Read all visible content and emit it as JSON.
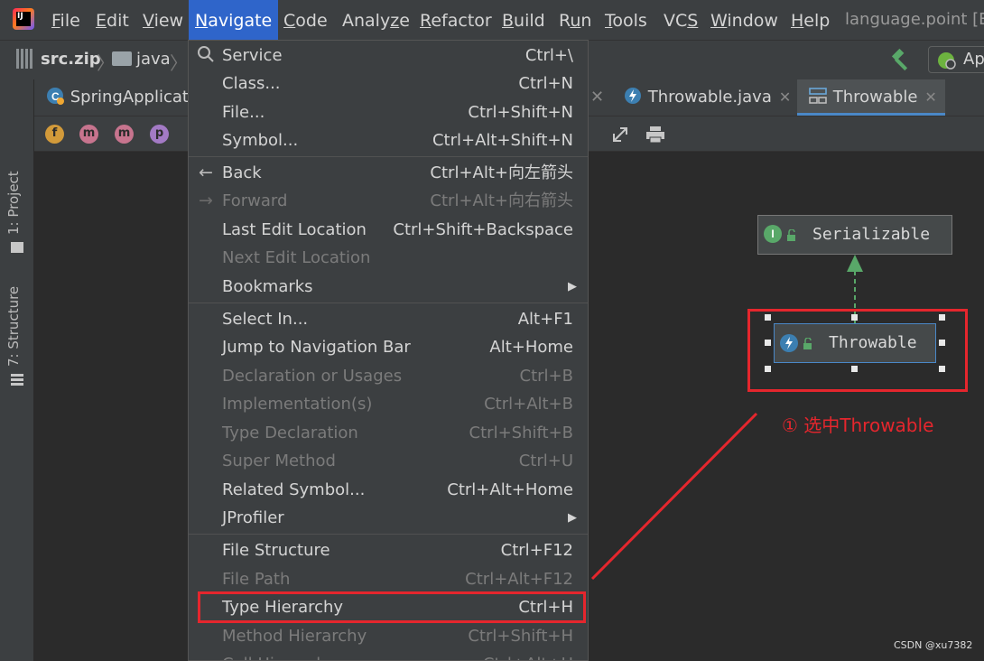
{
  "menubar": {
    "items": [
      {
        "label": "File",
        "u": "F"
      },
      {
        "label": "Edit",
        "u": "E"
      },
      {
        "label": "View",
        "u": "V"
      },
      {
        "label": "Navigate",
        "u": "N"
      },
      {
        "label": "Code",
        "u": "C"
      },
      {
        "label": "Analyze",
        "u": "z"
      },
      {
        "label": "Refactor",
        "u": "R"
      },
      {
        "label": "Build",
        "u": "B"
      },
      {
        "label": "Run",
        "u": "u"
      },
      {
        "label": "Tools",
        "u": "T"
      },
      {
        "label": "VCS",
        "u": "S"
      },
      {
        "label": "Window",
        "u": "W"
      },
      {
        "label": "Help",
        "u": "H"
      }
    ],
    "window_title": "language.point [Ex"
  },
  "navbar": {
    "crumb_zip": "src.zip",
    "crumb_java": "java",
    "run_button_label": "Ap"
  },
  "left_strip": {
    "project_tab": "1: Project",
    "structure_tab": "7: Structure"
  },
  "tabs": {
    "spring_app": "SpringApplicat",
    "throwable_java": "Throwable.java",
    "throwable_diagram": "Throwable"
  },
  "toolbar": {
    "filters": [
      "f",
      "m",
      "m",
      "p"
    ]
  },
  "navigate_menu": {
    "items": [
      {
        "label": "Service",
        "shortcut": "Ctrl+\\",
        "icon": "search-icon",
        "disabled": false
      },
      {
        "label": "Class...",
        "shortcut": "Ctrl+N",
        "disabled": false
      },
      {
        "label": "File...",
        "shortcut": "Ctrl+Shift+N",
        "disabled": false
      },
      {
        "label": "Symbol...",
        "shortcut": "Ctrl+Alt+Shift+N",
        "disabled": false
      },
      {
        "label": "Back",
        "shortcut": "Ctrl+Alt+向左箭头",
        "icon": "back-arrow-icon",
        "disabled": false
      },
      {
        "label": "Forward",
        "shortcut": "Ctrl+Alt+向右箭头",
        "icon": "forward-arrow-icon",
        "disabled": true
      },
      {
        "label": "Last Edit Location",
        "shortcut": "Ctrl+Shift+Backspace",
        "disabled": false
      },
      {
        "label": "Next Edit Location",
        "shortcut": "",
        "disabled": true
      },
      {
        "label": "Bookmarks",
        "shortcut": "",
        "submenu": true,
        "disabled": false
      },
      {
        "label": "Select In...",
        "shortcut": "Alt+F1",
        "disabled": false
      },
      {
        "label": "Jump to Navigation Bar",
        "shortcut": "Alt+Home",
        "disabled": false
      },
      {
        "label": "Declaration or Usages",
        "shortcut": "Ctrl+B",
        "disabled": true
      },
      {
        "label": "Implementation(s)",
        "shortcut": "Ctrl+Alt+B",
        "disabled": true
      },
      {
        "label": "Type Declaration",
        "shortcut": "Ctrl+Shift+B",
        "disabled": true
      },
      {
        "label": "Super Method",
        "shortcut": "Ctrl+U",
        "disabled": true
      },
      {
        "label": "Related Symbol...",
        "shortcut": "Ctrl+Alt+Home",
        "disabled": false
      },
      {
        "label": "JProfiler",
        "shortcut": "",
        "submenu": true,
        "disabled": false
      },
      {
        "label": "File Structure",
        "shortcut": "Ctrl+F12",
        "disabled": false
      },
      {
        "label": "File Path",
        "shortcut": "Ctrl+Alt+F12",
        "disabled": true
      },
      {
        "label": "Type Hierarchy",
        "shortcut": "Ctrl+H",
        "disabled": false,
        "highlighted": true
      },
      {
        "label": "Method Hierarchy",
        "shortcut": "Ctrl+Shift+H",
        "disabled": true
      },
      {
        "label": "Call Hierarchy",
        "shortcut": "Ctrl+Alt+H",
        "disabled": true
      }
    ]
  },
  "diagram": {
    "serializable": "Serializable",
    "throwable": "Throwable",
    "interface_badge": "I"
  },
  "annotation": {
    "text": "① 选中Throwable",
    "color": "#e5262d"
  },
  "watermark": "CSDN @xu7382"
}
